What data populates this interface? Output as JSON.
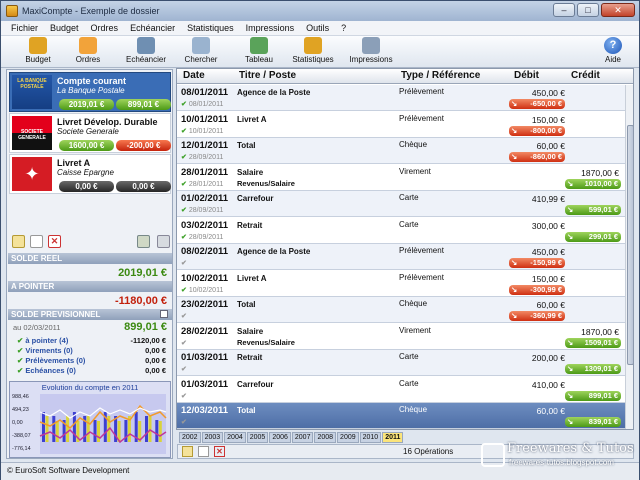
{
  "window": {
    "title": "MaxiCompte - Exemple de dossier",
    "min": "–",
    "max": "□",
    "close": "✕"
  },
  "menu": [
    "Fichier",
    "Budget",
    "Ordres",
    "Echéancier",
    "Statistiques",
    "Impressions",
    "Outils",
    "?"
  ],
  "toolbar": [
    {
      "label": "Budget",
      "icon": "budget-icon",
      "color": "#e0a323"
    },
    {
      "label": "Ordres",
      "icon": "gears-icon",
      "color": "#f2a33a"
    },
    {
      "label": "Echéancier",
      "icon": "stopwatch-icon",
      "color": "#6f8fb2"
    },
    {
      "label": "Chercher",
      "icon": "magnifier-icon",
      "color": "#9ab3cf"
    },
    {
      "label": "Tableau",
      "icon": "table-icon",
      "color": "#5aa35a"
    },
    {
      "label": "Statistiques",
      "icon": "bar-chart-icon",
      "color": "#e0a323"
    },
    {
      "label": "Impressions",
      "icon": "printer-icon",
      "color": "#8b9fb8"
    }
  ],
  "help": {
    "label": "Aide"
  },
  "accounts": [
    {
      "name": "Compte courant",
      "bank": "La Banque Postale",
      "logo_text": "LA BANQUE POSTALE",
      "bal1": "2019,01 €",
      "bal1_color": "g",
      "bal2": "899,01 €",
      "bal2_color": "g"
    },
    {
      "name": "Livret Dévelop. Durable",
      "bank": "Societe Generale",
      "logo_text": "SOCIETE GENERALE",
      "bal1": "1600,00 €",
      "bal1_color": "g",
      "bal2": "-200,00 €",
      "bal2_color": "r"
    },
    {
      "name": "Livret A",
      "bank": "Caisse Epargne",
      "logo_text": "",
      "bal1": "0,00 €",
      "bal1_color": "k",
      "bal2": "0,00 €",
      "bal2_color": "k"
    }
  ],
  "summary": {
    "solde_reel_label": "SOLDE REEL",
    "solde_reel": "2019,01 €",
    "a_pointer_label": "A POINTER",
    "a_pointer": "-1180,00 €",
    "prev_label": "SOLDE PREVISIONNEL",
    "prev_date": "au 02/03/2011",
    "prev_value": "899,01 €",
    "details": [
      {
        "label": "à pointer (4)",
        "value": "-1120,00 €"
      },
      {
        "label": "Virements (0)",
        "value": "0,00 €"
      },
      {
        "label": "Prélèvements (0)",
        "value": "0,00 €"
      },
      {
        "label": "Echéances (0)",
        "value": "0,00 €"
      }
    ]
  },
  "mini_chart": {
    "title": "Evolution du compte en 2011",
    "yticks": [
      "988,46",
      "494,23",
      "0,00",
      "-388,07",
      "-776,14"
    ]
  },
  "table": {
    "headers": {
      "date": "Date",
      "titre": "Titre / Poste",
      "type": "Type / Référence",
      "debit": "Débit",
      "credit": "Crédit"
    },
    "rows": [
      {
        "date": "08/01/2011",
        "sub_date": "08/01/2011",
        "titre": "Agence de la Poste",
        "sub": "",
        "type": "Prélèvement",
        "debit": "450,00 €",
        "credit": "",
        "balance": "-650,00 €",
        "bal_color": "r",
        "checked": true
      },
      {
        "date": "10/01/2011",
        "sub_date": "10/01/2011",
        "titre": "Livret A",
        "sub": "",
        "type": "Prélèvement",
        "debit": "150,00 €",
        "credit": "",
        "balance": "-800,00 €",
        "bal_color": "r",
        "checked": true
      },
      {
        "date": "12/01/2011",
        "sub_date": "28/09/2011",
        "titre": "Total",
        "sub": "",
        "type": "Chèque",
        "debit": "60,00 €",
        "credit": "",
        "balance": "-860,00 €",
        "bal_color": "r",
        "checked": true
      },
      {
        "date": "28/01/2011",
        "sub_date": "28/01/2011",
        "titre": "Salaire",
        "sub": "Revenus/Salaire",
        "type": "Virement",
        "debit": "",
        "credit": "1870,00 €",
        "balance": "1010,00 €",
        "bal_color": "g",
        "checked": true
      },
      {
        "date": "01/02/2011",
        "sub_date": "28/09/2011",
        "titre": "Carrefour",
        "sub": "",
        "type": "Carte",
        "debit": "410,99 €",
        "credit": "",
        "balance": "599,01 €",
        "bal_color": "g",
        "checked": true
      },
      {
        "date": "03/02/2011",
        "sub_date": "28/09/2011",
        "titre": "Retrait",
        "sub": "",
        "type": "Carte",
        "debit": "300,00 €",
        "credit": "",
        "balance": "299,01 €",
        "bal_color": "g",
        "checked": true
      },
      {
        "date": "08/02/2011",
        "sub_date": "",
        "titre": "Agence de la Poste",
        "sub": "",
        "type": "Prélèvement",
        "debit": "450,00 €",
        "credit": "",
        "balance": "-150,99 €",
        "bal_color": "r",
        "checked": false
      },
      {
        "date": "10/02/2011",
        "sub_date": "10/02/2011",
        "titre": "Livret A",
        "sub": "",
        "type": "Prélèvement",
        "debit": "150,00 €",
        "credit": "",
        "balance": "-300,99 €",
        "bal_color": "r",
        "checked": true
      },
      {
        "date": "23/02/2011",
        "sub_date": "",
        "titre": "Total",
        "sub": "",
        "type": "Chèque",
        "debit": "60,00 €",
        "credit": "",
        "balance": "-360,99 €",
        "bal_color": "r",
        "checked": false
      },
      {
        "date": "28/02/2011",
        "sub_date": "",
        "titre": "Salaire",
        "sub": "Revenus/Salaire",
        "type": "Virement",
        "debit": "",
        "credit": "1870,00 €",
        "balance": "1509,01 €",
        "bal_color": "g",
        "checked": false
      },
      {
        "date": "01/03/2011",
        "sub_date": "",
        "titre": "Retrait",
        "sub": "",
        "type": "Carte",
        "debit": "200,00 €",
        "credit": "",
        "balance": "1309,01 €",
        "bal_color": "g",
        "checked": false
      },
      {
        "date": "01/03/2011",
        "sub_date": "",
        "titre": "Carrefour",
        "sub": "",
        "type": "Carte",
        "debit": "410,00 €",
        "credit": "",
        "balance": "899,01 €",
        "bal_color": "g",
        "checked": false
      },
      {
        "date": "12/03/2011",
        "sub_date": "",
        "titre": "Total",
        "sub": "",
        "type": "Chèque",
        "debit": "60,00 €",
        "credit": "",
        "balance": "839,01 €",
        "bal_color": "g",
        "checked": false
      }
    ]
  },
  "years": [
    "2002",
    "2003",
    "2004",
    "2005",
    "2006",
    "2007",
    "2008",
    "2009",
    "2010",
    "2011"
  ],
  "current_year": "2011",
  "operations": "16 Opérations",
  "status": "© EuroSoft Software Development",
  "watermark": {
    "title": "Freewares & Tutos",
    "url": "freewares-tutos.blogspot.com"
  }
}
